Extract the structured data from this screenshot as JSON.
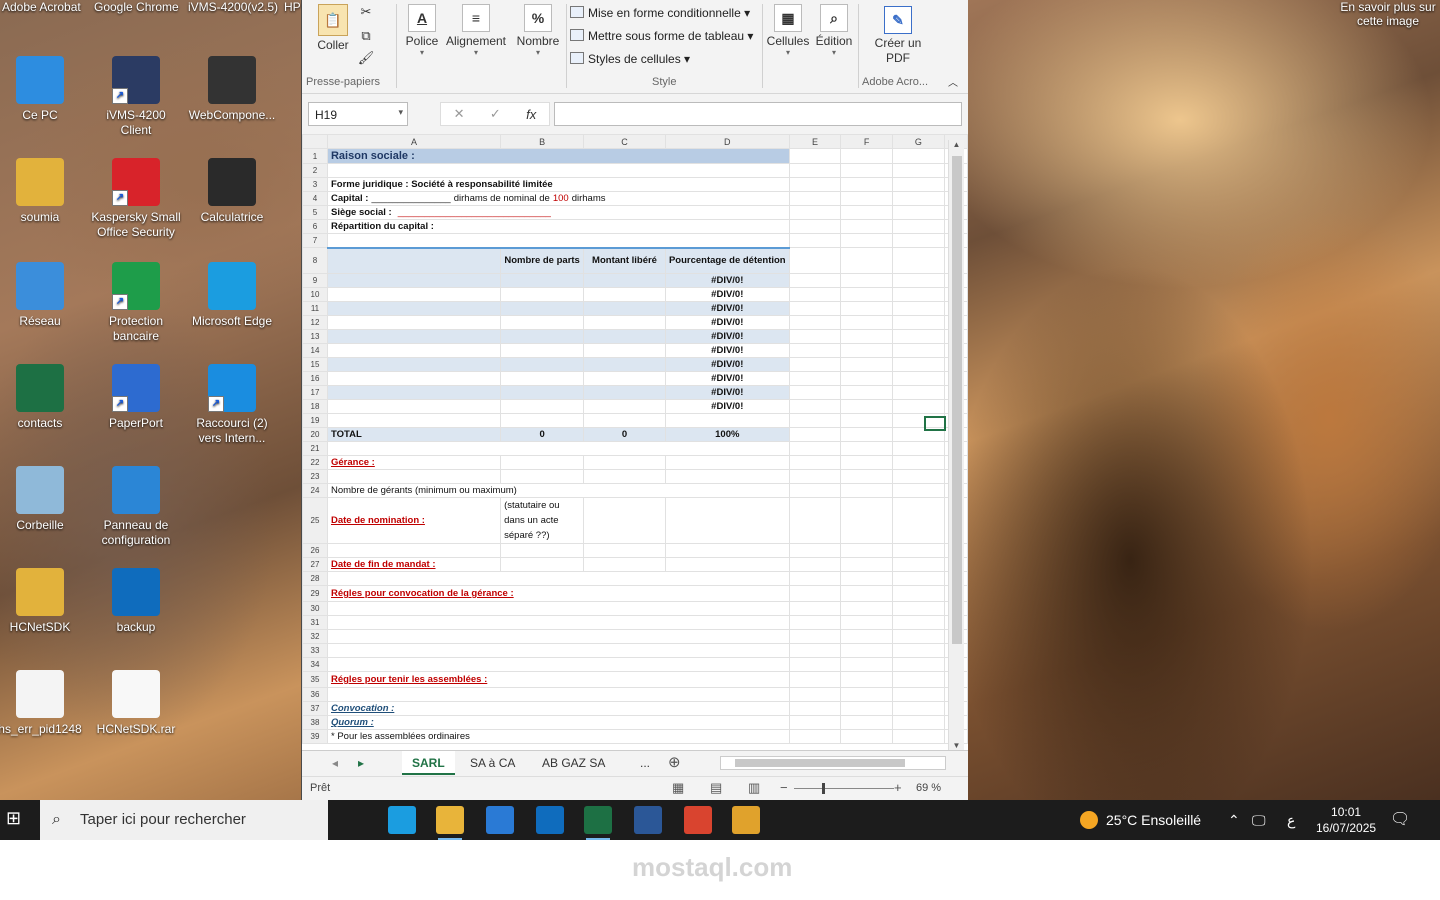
{
  "desktop": {
    "top_strip": [
      "Adobe Acrobat",
      "Google Chrome",
      "iVMS-4200(v2.5)",
      "HP"
    ],
    "spotlight": "En savoir plus sur cette image",
    "icons": [
      {
        "label": "Ce PC",
        "icon": "computer-icon",
        "color": "#2d8de0"
      },
      {
        "label": "iVMS-4200 Client",
        "icon": "camera-icon",
        "color": "#2b3b63"
      },
      {
        "label": "WebCompone...",
        "icon": "webcam-icon",
        "color": "#333333"
      },
      {
        "label": "soumia",
        "icon": "user-folder-icon",
        "color": "#e2b23c"
      },
      {
        "label": "Kaspersky Small Office Security",
        "icon": "kaspersky-icon",
        "color": "#d8232a"
      },
      {
        "label": "Calculatrice",
        "icon": "calculator-icon",
        "color": "#2a2a2a"
      },
      {
        "label": "Réseau",
        "icon": "network-icon",
        "color": "#3b8edb"
      },
      {
        "label": "Protection bancaire",
        "icon": "card-icon",
        "color": "#1e9d4a"
      },
      {
        "label": "Microsoft Edge",
        "icon": "edge-icon",
        "color": "#1b9de0"
      },
      {
        "label": "contacts",
        "icon": "excel-file-icon",
        "color": "#1d7044"
      },
      {
        "label": "PaperPort",
        "icon": "paperport-icon",
        "color": "#2d6bd0"
      },
      {
        "label": "Raccourci (2) vers Intern...",
        "icon": "ie-icon",
        "color": "#1a8de0"
      },
      {
        "label": "Corbeille",
        "icon": "recycle-bin-icon",
        "color": "#8fb9d9"
      },
      {
        "label": "Panneau de configuration",
        "icon": "control-panel-icon",
        "color": "#2b86d6"
      },
      {
        "label": "HCNetSDK",
        "icon": "folder-icon",
        "color": "#e2b23c"
      },
      {
        "label": "backup",
        "icon": "outlook-file-icon",
        "color": "#0f6cbd"
      },
      {
        "label": "hs_err_pid1248",
        "icon": "text-file-icon",
        "color": "#f4f4f4"
      },
      {
        "label": "HCNetSDK.rar",
        "icon": "blank-file-icon",
        "color": "#f8f8f8"
      }
    ]
  },
  "ribbon": {
    "paste": "Coller",
    "clipboard_group": "Presse-papiers",
    "font": "Police",
    "alignment": "Alignement",
    "number": "Nombre",
    "number_symbol": "%",
    "style_items": [
      "Mise en forme conditionnelle",
      "Mettre sous forme de tableau",
      "Styles de cellules"
    ],
    "style_group": "Style",
    "cells": "Cellules",
    "editing": "Édition",
    "create_pdf": "Créer un PDF",
    "acrobat_group": "Adobe Acro..."
  },
  "formula_bar": {
    "name_box": "H19",
    "fx": "fx",
    "value": ""
  },
  "sheet": {
    "columns": [
      "A",
      "B",
      "C",
      "D",
      "E",
      "F",
      "G"
    ],
    "title": "Raison sociale :",
    "forme": "Forme juridique : Société à responsabilité limitée",
    "capital_label": "Capital :",
    "capital_blank": "_______________",
    "capital_text1": "dirhams de nominal de",
    "capital_nominal": "100",
    "capital_text2": "dirhams",
    "siege_label": "Siège social :",
    "siege_blank": "_____________________________",
    "repartition": "Répartition du capital :",
    "hdr_parts": "Nombre de parts",
    "hdr_montant": "Montant libéré",
    "hdr_pct": "Pourcentage de détention",
    "div_error": "#DIV/0!",
    "total_label": "TOTAL",
    "total_parts": "0",
    "total_montant": "0",
    "total_pct": "100%",
    "gerance": "Gérance :",
    "nb_gerants": "Nombre de gérants (minimum ou maximum)",
    "date_nomination": "Date de nomination :",
    "statutaire": "(statutaire ou dans un acte séparé ??)",
    "date_fin": "Date de fin de mandat :",
    "regles_convocation": "Régles pour convocation de la gérance :",
    "regles_assemblees": "Régles pour tenir les assemblées :",
    "convocation": "Convocation :",
    "quorum": "Quorum :",
    "ordinaires": "* Pour les assemblées ordinaires"
  },
  "tabs": [
    "SARL",
    "SA à CA",
    "AB GAZ SA",
    "..."
  ],
  "status": {
    "ready": "Prêt",
    "zoom": "69 %"
  },
  "taskbar": {
    "search_placeholder": "Taper ici pour rechercher",
    "weather": "25°C  Ensoleillé",
    "lang": "ع",
    "time": "10:01",
    "date": "16/07/2025",
    "apps": [
      {
        "name": "task-view-icon",
        "color": "#1c1c1c"
      },
      {
        "name": "edge-icon",
        "color": "#1b9de0"
      },
      {
        "name": "file-explorer-icon",
        "color": "#e8b43a"
      },
      {
        "name": "store-icon",
        "color": "#2a7ad5"
      },
      {
        "name": "outlook-icon",
        "color": "#0f6cbd"
      },
      {
        "name": "excel-icon",
        "color": "#1d7044"
      },
      {
        "name": "word-icon",
        "color": "#2b5797"
      },
      {
        "name": "chrome-icon",
        "color": "#d9442f"
      },
      {
        "name": "chrome-profile-icon",
        "color": "#e0a22c"
      }
    ]
  },
  "watermark": "mostaql.com"
}
